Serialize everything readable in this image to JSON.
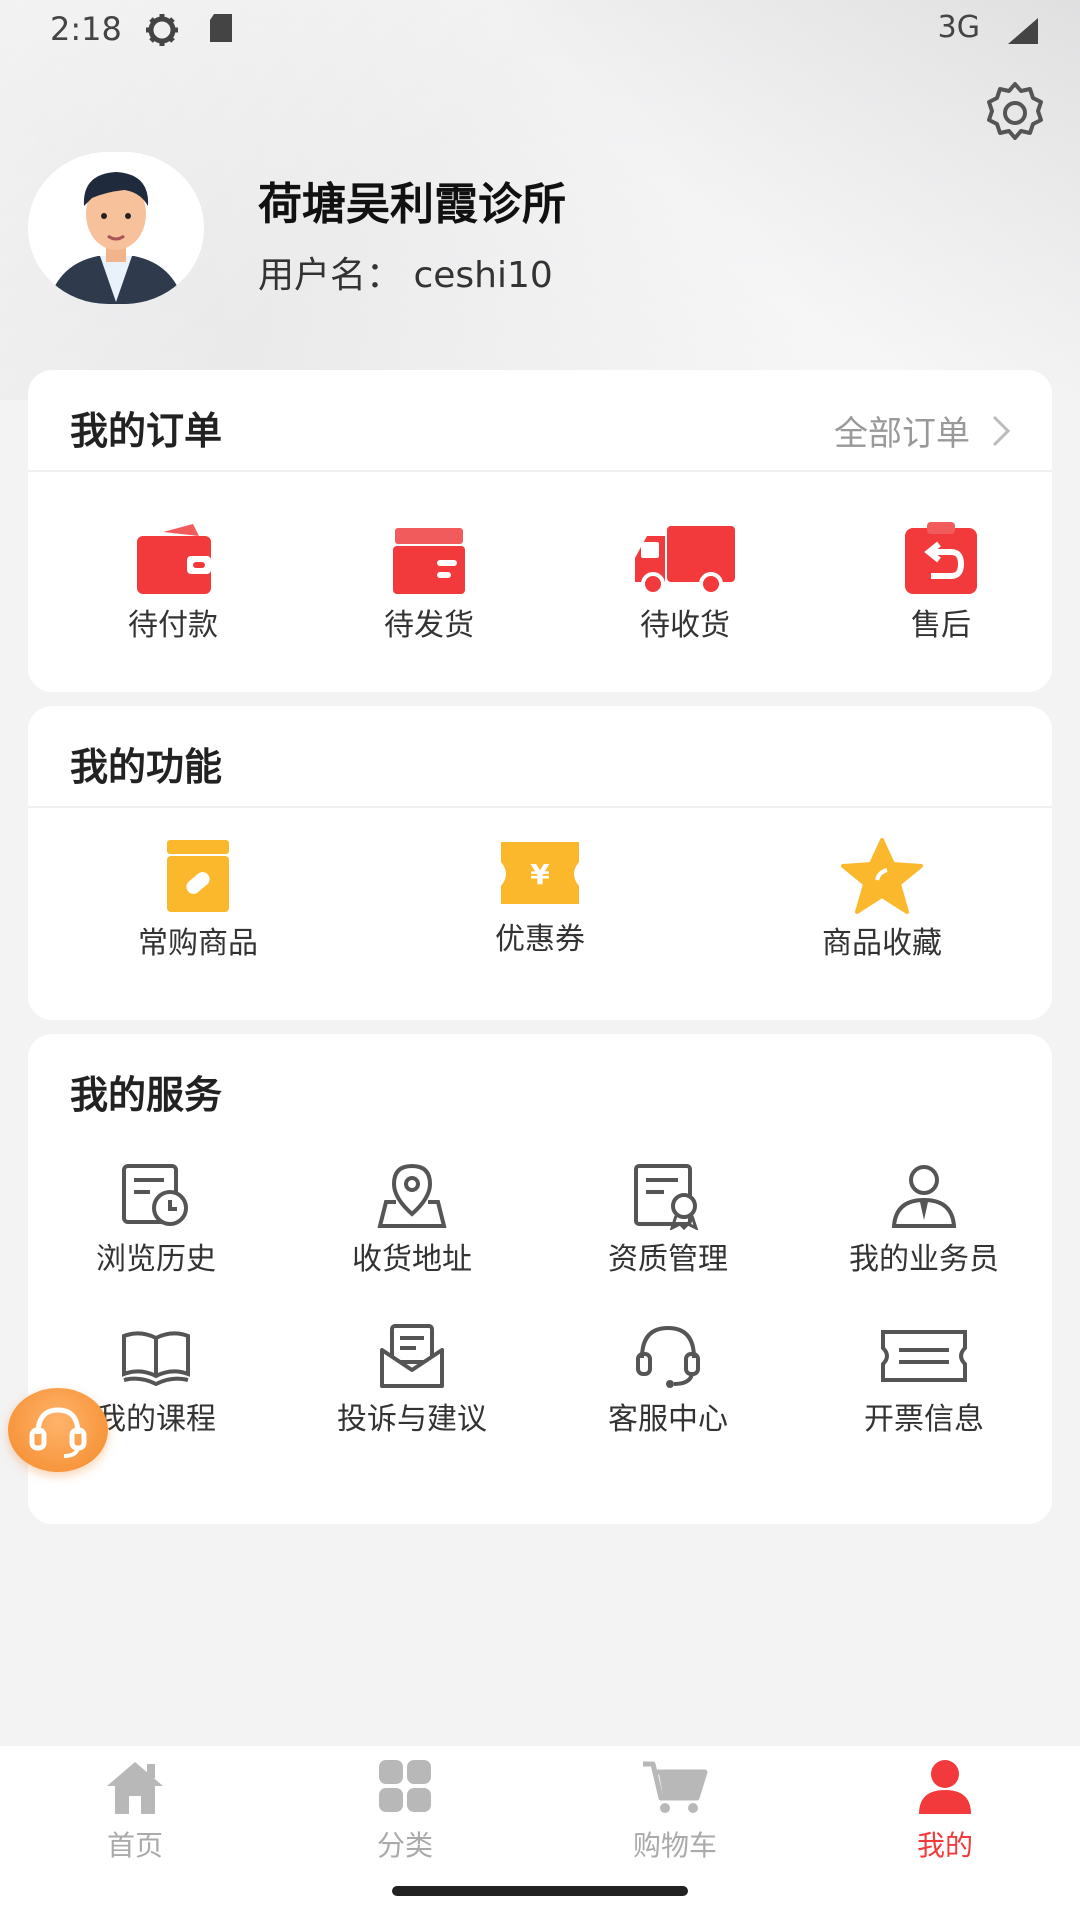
{
  "status_bar": {
    "time": "2:18",
    "network": "3G"
  },
  "profile": {
    "shop_name": "荷塘吴利霞诊所",
    "username_line": "用户名：  ceshi10"
  },
  "orders": {
    "title": "我的订单",
    "all_label": "全部订单",
    "items": [
      {
        "label": "待付款",
        "icon": "wallet-icon"
      },
      {
        "label": "待发货",
        "icon": "box-icon"
      },
      {
        "label": "待收货",
        "icon": "truck-icon"
      },
      {
        "label": "售后",
        "icon": "return-icon"
      }
    ]
  },
  "functions": {
    "title": "我的功能",
    "items": [
      {
        "label": "常购商品",
        "icon": "medicine-box-icon"
      },
      {
        "label": "优惠券",
        "icon": "coupon-icon"
      },
      {
        "label": "商品收藏",
        "icon": "star-icon"
      }
    ]
  },
  "services": {
    "title": "我的服务",
    "items": [
      {
        "label": "浏览历史",
        "icon": "history-icon"
      },
      {
        "label": "收货地址",
        "icon": "location-icon"
      },
      {
        "label": "资质管理",
        "icon": "certificate-icon"
      },
      {
        "label": "我的业务员",
        "icon": "salesperson-icon"
      },
      {
        "label": "我的课程",
        "icon": "book-icon"
      },
      {
        "label": "投诉与建议",
        "icon": "feedback-icon"
      },
      {
        "label": "客服中心",
        "icon": "headset-icon"
      },
      {
        "label": "开票信息",
        "icon": "invoice-icon"
      }
    ]
  },
  "tabbar": {
    "items": [
      {
        "label": "首页",
        "icon": "home-icon"
      },
      {
        "label": "分类",
        "icon": "category-icon"
      },
      {
        "label": "购物车",
        "icon": "cart-icon"
      },
      {
        "label": "我的",
        "icon": "person-icon"
      }
    ],
    "active": "我的"
  },
  "colors": {
    "accent": "#f23a3c",
    "yellow": "#fbb82c",
    "inactive": "#b8b8b8"
  }
}
